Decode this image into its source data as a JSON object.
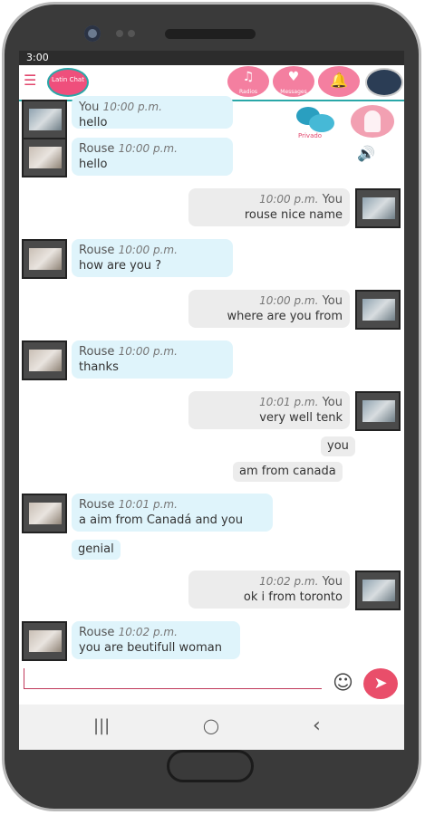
{
  "status": {
    "time": "3:00"
  },
  "topbar": {
    "logo_text": "Latin Chat",
    "icons": [
      {
        "name": "radios-icon",
        "label": "Radios"
      },
      {
        "name": "hearts-icon",
        "label": "Messages"
      },
      {
        "name": "bell-icon",
        "label": ""
      }
    ]
  },
  "privado": {
    "label": "Privado"
  },
  "messages": [
    {
      "side": "in",
      "sender": "You",
      "time": "10:00 p.m.",
      "text": "hello"
    },
    {
      "side": "in",
      "sender": "Rouse",
      "time": "10:00 p.m.",
      "text": "hello"
    },
    {
      "side": "out",
      "sender": "You",
      "time": "10:00 p.m.",
      "text": "rouse nice name"
    },
    {
      "side": "in",
      "sender": "Rouse",
      "time": "10:00 p.m.",
      "text": "how are you ?"
    },
    {
      "side": "out",
      "sender": "You",
      "time": "10:00 p.m.",
      "text": "where are you from"
    },
    {
      "side": "in",
      "sender": "Rouse",
      "time": "10:00 p.m.",
      "text": "thanks"
    },
    {
      "side": "out",
      "sender": "You",
      "time": "10:01 p.m.",
      "text": "very well tenk"
    },
    {
      "side": "out",
      "text": "you"
    },
    {
      "side": "out",
      "text": "am from canada"
    },
    {
      "side": "in",
      "sender": "Rouse",
      "time": "10:01 p.m.",
      "text": "a aim from Canadá and you"
    },
    {
      "side": "in",
      "text": "genial"
    },
    {
      "side": "out",
      "sender": "You",
      "time": "10:02 p.m.",
      "text": "ok i from toronto"
    },
    {
      "side": "in",
      "sender": "Rouse",
      "time": "10:02 p.m.",
      "text": "you are beutifull woman"
    }
  ],
  "input": {
    "placeholder": "",
    "send_icon": "send-icon",
    "emoji_icon": "smiley-icon"
  },
  "nav": {
    "recent": "|||",
    "home": "◯",
    "back": "‹"
  },
  "colors": {
    "accent": "#2aa7a8",
    "brand": "#ef4f7c",
    "incoming": "#dff4fb",
    "outgoing": "#ececec"
  }
}
